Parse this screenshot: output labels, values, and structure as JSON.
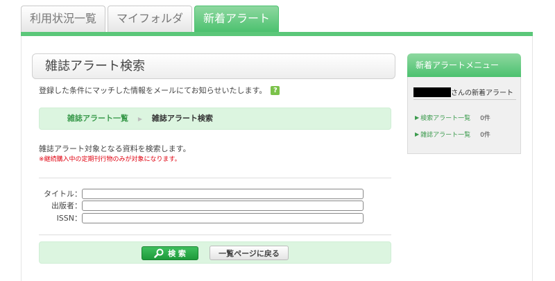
{
  "tabs": [
    {
      "label": "利用状況一覧",
      "active": false
    },
    {
      "label": "マイフォルダ",
      "active": false
    },
    {
      "label": "新着アラート",
      "active": true
    }
  ],
  "page_title": "雑誌アラート検索",
  "intro_text": "登録した条件にマッチした情報をメールにてお知らせいたします。",
  "help_icon": "?",
  "breadcrumb": {
    "link": "雑誌アラート一覧",
    "separator": "▶",
    "current": "雑誌アラート検索"
  },
  "description": "雑誌アラート対象となる資料を検索します。",
  "note": "※継続購入中の定期刊行物のみが対象になります。",
  "form": {
    "title_label": "タイトル：",
    "publisher_label": "出版者：",
    "issn_label": "ISSN：",
    "title_value": "",
    "publisher_value": "",
    "issn_value": ""
  },
  "buttons": {
    "search": "検 索",
    "back": "一覧ページに戻る"
  },
  "side_menu": {
    "header": "新着アラートメニュー",
    "user_suffix": "さんの新着アラート",
    "items": [
      {
        "label": "検索アラート一覧",
        "count": "0件"
      },
      {
        "label": "雑誌アラート一覧",
        "count": "0件"
      }
    ]
  },
  "colors": {
    "accent_green": "#4cc16f",
    "light_green": "#dcf5e0",
    "link_green": "#3a9a4c",
    "note_red": "#e0000f"
  }
}
